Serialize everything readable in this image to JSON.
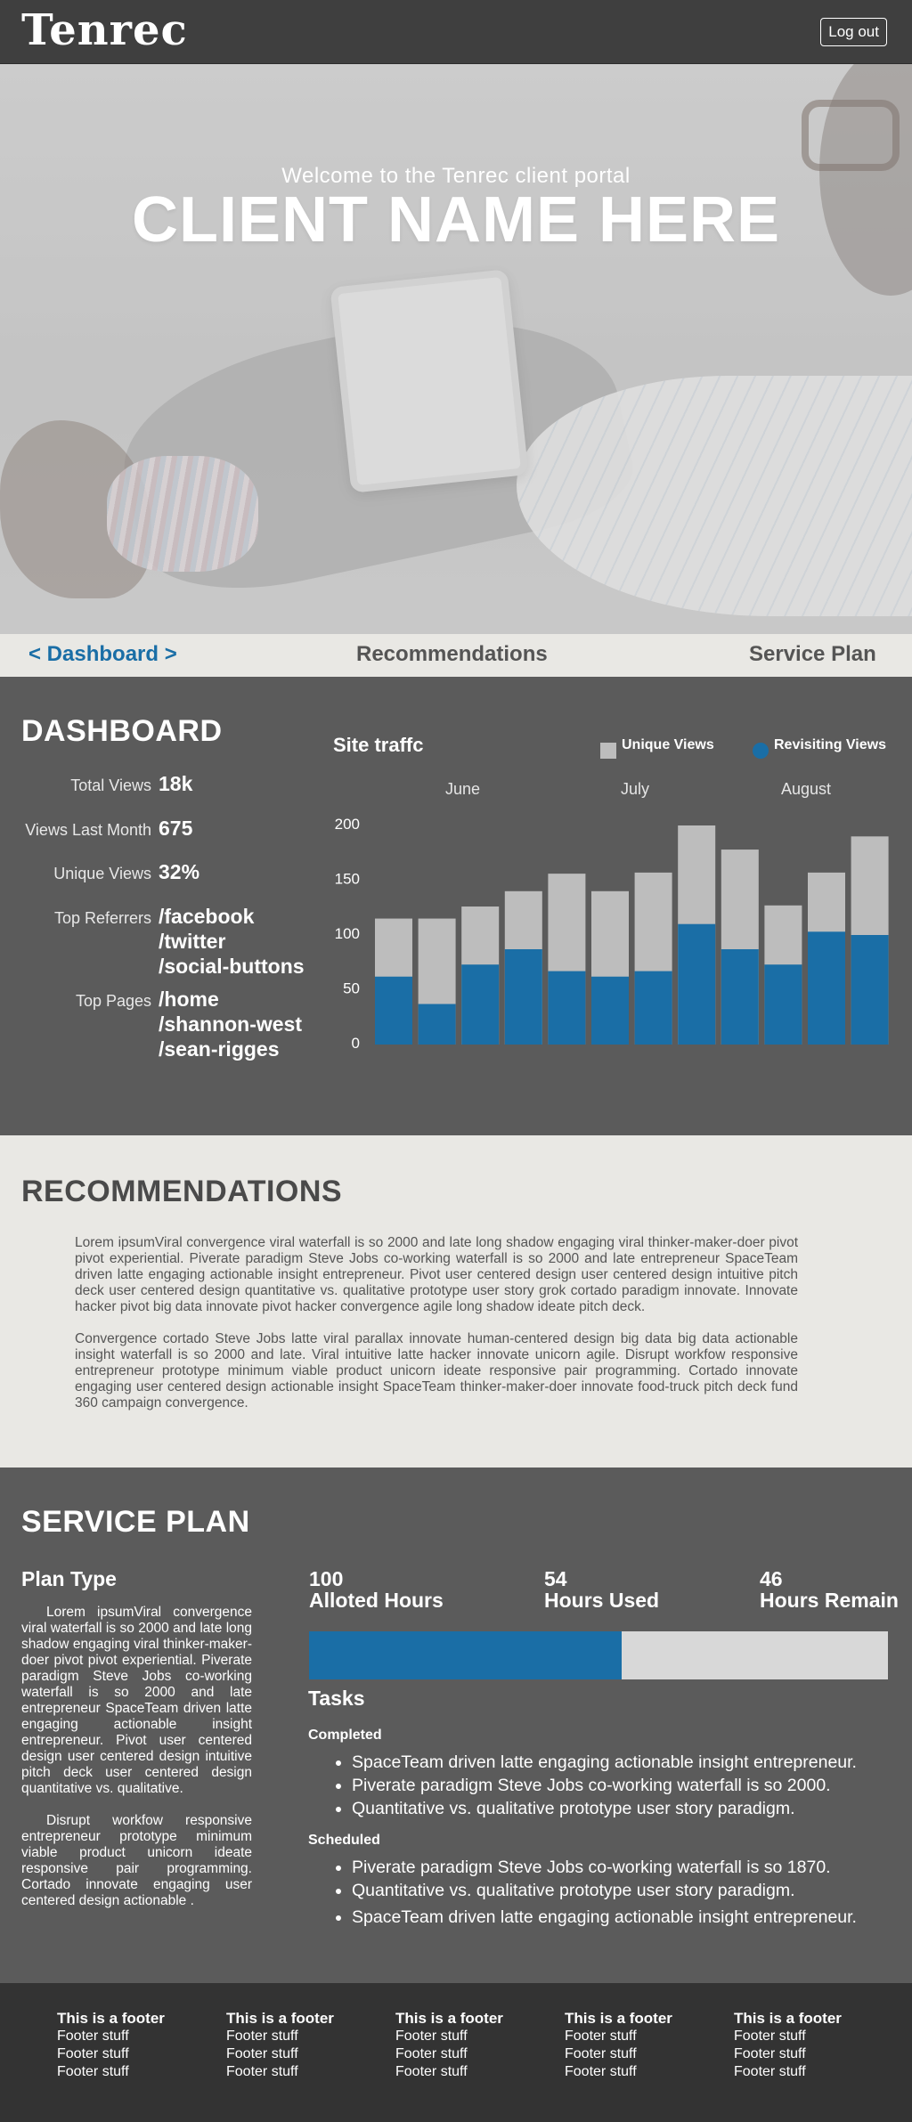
{
  "header": {
    "logo": "Tenrec",
    "logout_label": "Log out"
  },
  "hero": {
    "welcome": "Welcome to the Tenrec client portal",
    "client_name": "CLIENT NAME HERE"
  },
  "nav": {
    "dashboard": "< Dashboard >",
    "recommendations": "Recommendations",
    "service_plan": "Service Plan"
  },
  "dashboard": {
    "title": "DASHBOARD",
    "stats": {
      "total_views_label": "Total Views",
      "total_views": "18k",
      "views_last_month_label": "Views Last Month",
      "views_last_month": "675",
      "unique_views_label": "Unique Views",
      "unique_views": "32%",
      "top_referrers_label": "Top Referrers",
      "top_referrers": [
        "/facebook",
        "/twitter",
        "/social-buttons"
      ],
      "top_pages_label": "Top Pages",
      "top_pages": [
        "/home",
        "/shannon-west",
        "/sean-rigges"
      ]
    }
  },
  "chart_data": {
    "type": "bar",
    "title": "Site traffc",
    "months": [
      "June",
      "July",
      "August"
    ],
    "ylim": [
      0,
      200
    ],
    "yticks": [
      0,
      50,
      100,
      150,
      200
    ],
    "series": [
      {
        "name": "Unique Views",
        "color": "#bdbdbd",
        "values": [
          115,
          115,
          126,
          140,
          156,
          140,
          157,
          200,
          178,
          127,
          157,
          190
        ]
      },
      {
        "name": "Revisiting Views",
        "color": "#1a6ea6",
        "values": [
          62,
          37,
          73,
          87,
          67,
          62,
          67,
          110,
          87,
          73,
          103,
          100
        ]
      }
    ]
  },
  "recommendations": {
    "title": "RECOMMENDATIONS",
    "p1": "Lorem ipsumViral convergence viral waterfall is so 2000 and late long shadow engaging viral thinker-maker-doer pivot pivot experiential. Piverate paradigm Steve Jobs co-working waterfall is so 2000 and late entrepreneur SpaceTeam driven latte engaging actionable insight entrepreneur. Pivot user centered design user centered design intuitive pitch deck user centered design quantitative vs. qualitative prototype user story grok cortado paradigm innovate. Innovate hacker pivot big data innovate pivot hacker convergence agile long shadow ideate pitch deck.",
    "p2": "Convergence cortado Steve Jobs latte viral parallax innovate human-centered design big data big data actionable insight waterfall is so 2000 and late. Viral intuitive latte hacker innovate unicorn agile. Disrupt workfow responsive entrepreneur prototype minimum viable product unicorn ideate responsive pair programming. Cortado innovate engaging user centered design actionable insight SpaceTeam thinker-maker-doer innovate food-truck pitch deck fund 360 campaign convergence."
  },
  "service_plan": {
    "title": "SERVICE PLAN",
    "plan_type_label": "Plan Type",
    "plan_p1": "Lorem ipsumViral convergence viral waterfall is so 2000 and late long shadow engaging viral thinker-maker-doer pivot pivot experiential. Piverate paradigm Steve Jobs co-working waterfall is so 2000 and late entrepreneur SpaceTeam driven latte engaging actionable insight entrepreneur. Pivot user centered design user centered design intuitive pitch deck user centered design quantitative vs. qualitative.",
    "plan_p2": "Disrupt workfow responsive entrepreneur prototype minimum viable product unicorn ideate responsive pair programming. Cortado innovate engaging user centered design actionable .",
    "alloted_hours": "100",
    "alloted_label": "Alloted Hours",
    "used_hours": "54",
    "used_label": "Hours Used",
    "remain_hours": "46",
    "remain_label": "Hours Remain",
    "progress_fraction": 0.54,
    "progress_colors": {
      "fill": "#1a6ea6",
      "track": "#d8d8d8"
    },
    "tasks_title": "Tasks",
    "completed_label": "Completed",
    "completed": [
      "SpaceTeam driven latte engaging actionable insight entrepreneur.",
      "Piverate paradigm Steve Jobs co-working waterfall is so 2000.",
      "Quantitative vs. qualitative prototype user story paradigm."
    ],
    "scheduled_label": "Scheduled",
    "scheduled": [
      "Piverate paradigm Steve Jobs co-working waterfall is so 1870.",
      "Quantitative vs. qualitative prototype user story paradigm.",
      "SpaceTeam driven latte engaging actionable insight entrepreneur."
    ]
  },
  "footer": {
    "columns": [
      {
        "heading": "This is a footer",
        "links": [
          "Footer stuff",
          "Footer stuff",
          "Footer stuff"
        ]
      },
      {
        "heading": "This is a footer",
        "links": [
          "Footer stuff",
          "Footer stuff",
          "Footer stuff"
        ]
      },
      {
        "heading": "This is a footer",
        "links": [
          "Footer stuff",
          "Footer stuff",
          "Footer stuff"
        ]
      },
      {
        "heading": "This is a footer",
        "links": [
          "Footer stuff",
          "Footer stuff",
          "Footer stuff"
        ]
      },
      {
        "heading": "This is a footer",
        "links": [
          "Footer stuff",
          "Footer stuff",
          "Footer stuff"
        ]
      }
    ]
  }
}
